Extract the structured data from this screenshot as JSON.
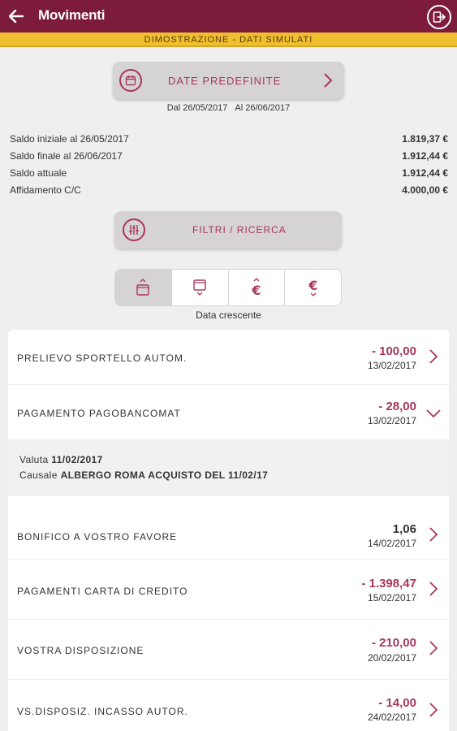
{
  "header": {
    "title": "Movimenti",
    "back_icon": "arrow-left-icon",
    "exit_icon": "logout-icon",
    "color": "#7d1b3c"
  },
  "banner": {
    "text": "DIMOSTRAZIONE - DATI SIMULATI",
    "color": "#efbf2f"
  },
  "date_button": {
    "label": "DATE PREDEFINITE",
    "icon": "calendar-icon"
  },
  "date_range": {
    "from": "Dal 26/05/2017",
    "to": "Al 26/06/2017"
  },
  "summary": [
    {
      "label": "Saldo iniziale al 26/05/2017",
      "value": "1.819,37 €"
    },
    {
      "label": "Saldo finale al 26/06/2017",
      "value": "1.912,44 €"
    },
    {
      "label": "Saldo attuale",
      "value": "1.912,44 €"
    },
    {
      "label": "Affidamento C/C",
      "value": "4.000,00 €"
    }
  ],
  "filter_button": {
    "label": "FILTRI / RICERCA",
    "icon": "sliders-icon"
  },
  "sort": {
    "label": "Data crescente",
    "options": [
      "date-ascending-icon",
      "date-descending-icon",
      "amount-ascending-icon",
      "amount-descending-icon"
    ],
    "active_index": 0
  },
  "transactions": [
    {
      "description": "PRELIEVO SPORTELLO AUTOM.",
      "amount": "- 100,00",
      "date": "13/02/2017"
    },
    {
      "description": "PAGAMENTO PAGOBANCOMAT",
      "amount": "- 28,00",
      "date": "13/02/2017",
      "expanded": true
    },
    {
      "description": "BONIFICO A VOSTRO FAVORE",
      "amount": "1,06",
      "date": "14/02/2017"
    },
    {
      "description": "PAGAMENTI CARTA DI CREDITO",
      "amount": "- 1.398,47",
      "date": "15/02/2017"
    },
    {
      "description": "VOSTRA DISPOSIZIONE",
      "amount": "- 210,00",
      "date": "20/02/2017"
    },
    {
      "description": "VS.DISPOSIZ. INCASSO AUTOR.",
      "amount": "- 14,00",
      "date": "24/02/2017"
    }
  ],
  "expanded_detail": {
    "valuta_label": "Valuta",
    "valuta_value": "11/02/2017",
    "causale_label": "Causale",
    "causale_value": "ALBERGO ROMA ACQUISTO DEL 11/02/17"
  },
  "accent_color": "#a8365a"
}
